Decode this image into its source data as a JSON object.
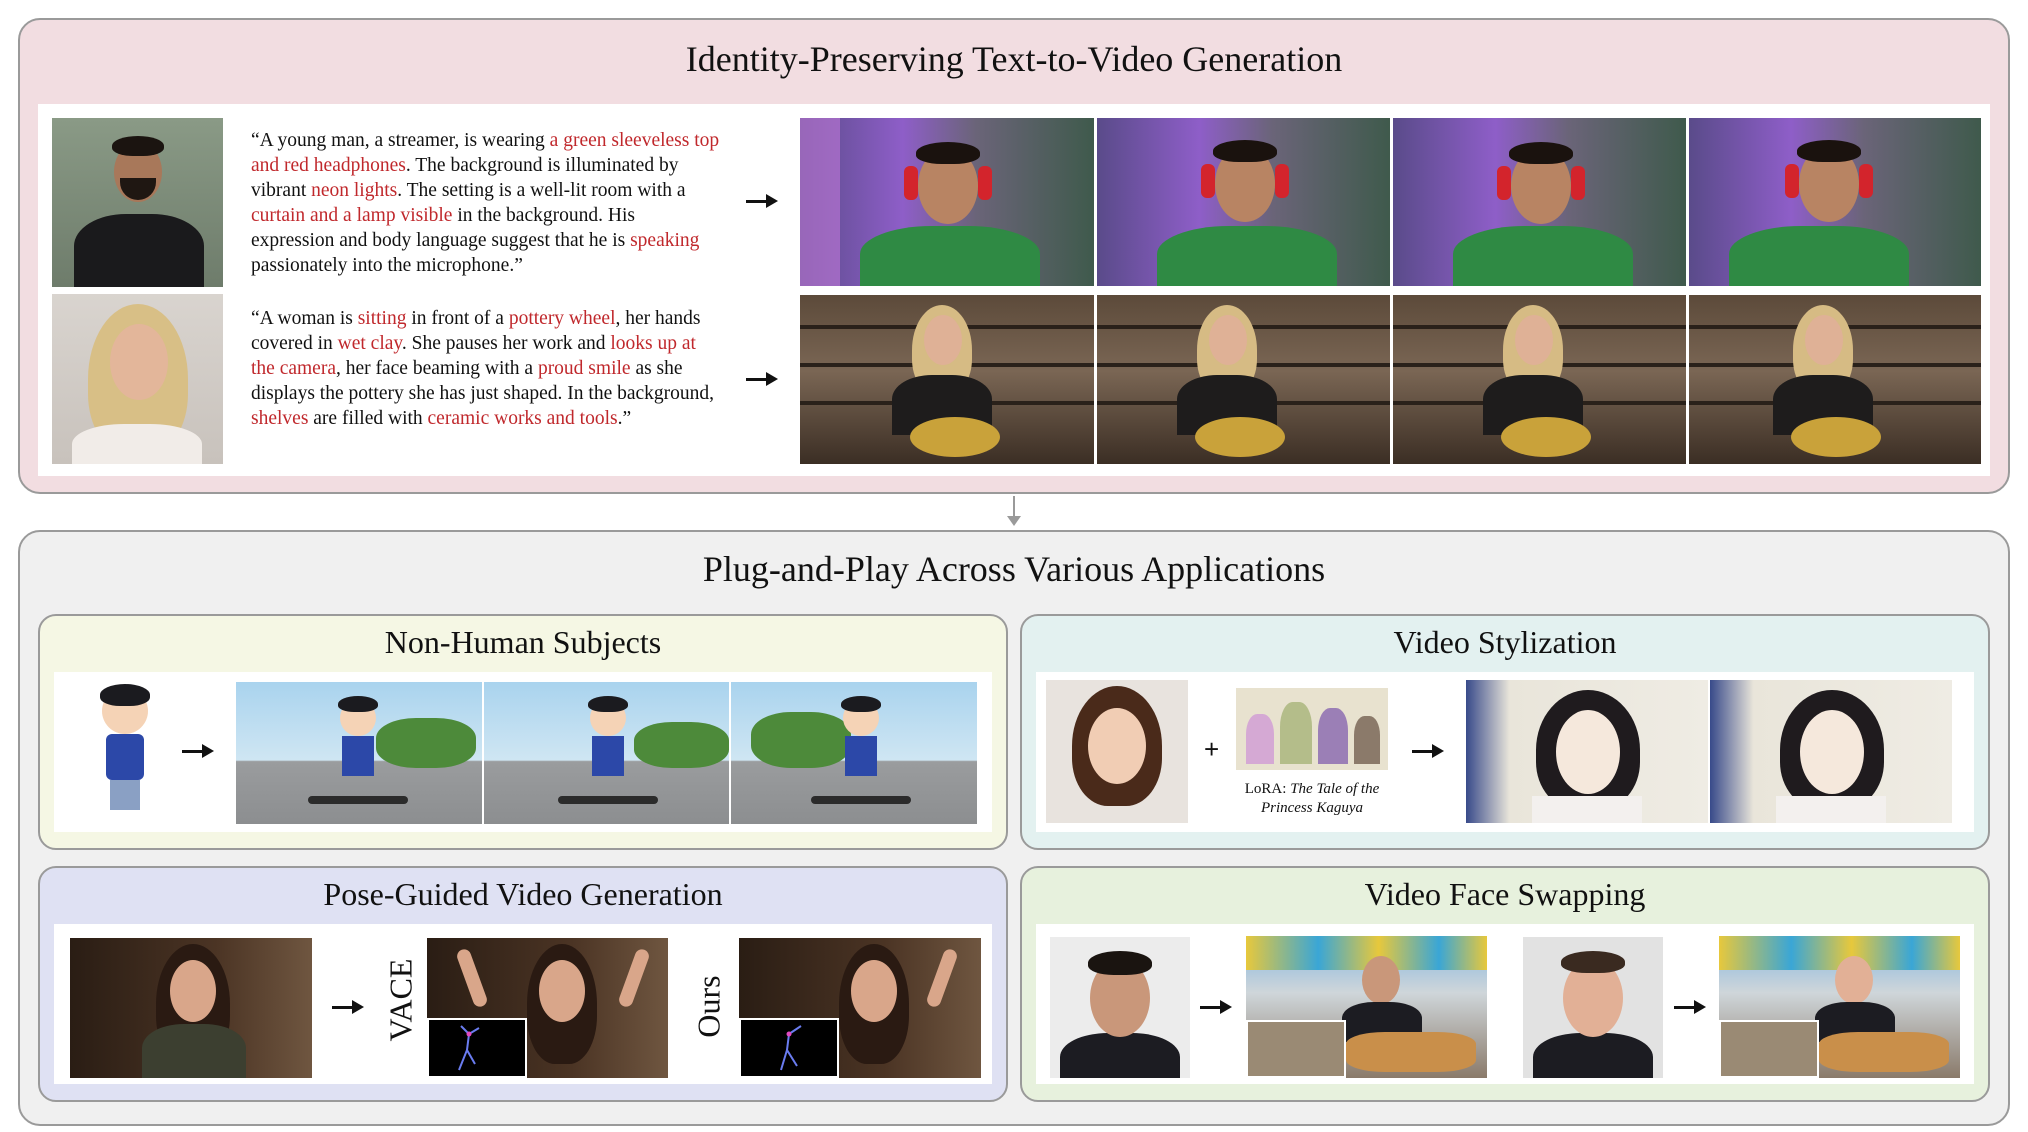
{
  "top_section": {
    "title": "Identity-Preserving Text-to-Video Generation",
    "row1": {
      "reference": "bearded man in black turtleneck with crossed arms",
      "prompt_parts": [
        {
          "t": "“A young man, a streamer, is wearing ",
          "h": false
        },
        {
          "t": "a green sleeveless top and red headphones",
          "h": true
        },
        {
          "t": ". The background is illuminated by vibrant ",
          "h": false
        },
        {
          "t": "neon lights",
          "h": true
        },
        {
          "t": ". The setting is a well-lit room with a ",
          "h": false
        },
        {
          "t": "curtain and a lamp visible",
          "h": true
        },
        {
          "t": " in the background. His expression and body language suggest that he is ",
          "h": false
        },
        {
          "t": "speaking",
          "h": true
        },
        {
          "t": " passionately into the microphone.”",
          "h": false
        }
      ]
    },
    "row2": {
      "reference": "smiling blonde woman with wavy hair",
      "prompt_parts": [
        {
          "t": "“A woman is ",
          "h": false
        },
        {
          "t": "sitting",
          "h": true
        },
        {
          "t": " in front of a ",
          "h": false
        },
        {
          "t": "pottery wheel",
          "h": true
        },
        {
          "t": ", her hands covered in ",
          "h": false
        },
        {
          "t": "wet clay",
          "h": true
        },
        {
          "t": ". She pauses her work and ",
          "h": false
        },
        {
          "t": "looks up at the camera",
          "h": true
        },
        {
          "t": ", her face beaming with a ",
          "h": false
        },
        {
          "t": "proud smile",
          "h": true
        },
        {
          "t": " as she displays the pottery she has just shaped. In the background, ",
          "h": false
        },
        {
          "t": "shelves",
          "h": true
        },
        {
          "t": " are filled with ",
          "h": false
        },
        {
          "t": "ceramic works and tools",
          "h": true
        },
        {
          "t": ".”",
          "h": false
        }
      ]
    }
  },
  "bottom_section": {
    "title": "Plug-and-Play Across Various Applications",
    "non_human": {
      "title": "Non-Human Subjects"
    },
    "stylization": {
      "title": "Video Stylization",
      "lora_prefix": "LoRA: ",
      "lora_name_line1": "The Tale of the",
      "lora_name_line2": "Princess Kaguya",
      "plus": "+"
    },
    "pose": {
      "title": "Pose-Guided Video Generation",
      "label_vace": "VACE",
      "label_ours": "Ours"
    },
    "face_swap": {
      "title": "Video Face Swapping"
    }
  },
  "colors": {
    "top_panel_bg": "#f2dde1",
    "bottom_panel_bg": "#f0f0f0",
    "non_human_bg": "#f5f7e4",
    "stylization_bg": "#e3f1f0",
    "pose_bg": "#dfe1f3",
    "face_swap_bg": "#e7f1dd",
    "highlight_text": "#c0282c"
  }
}
